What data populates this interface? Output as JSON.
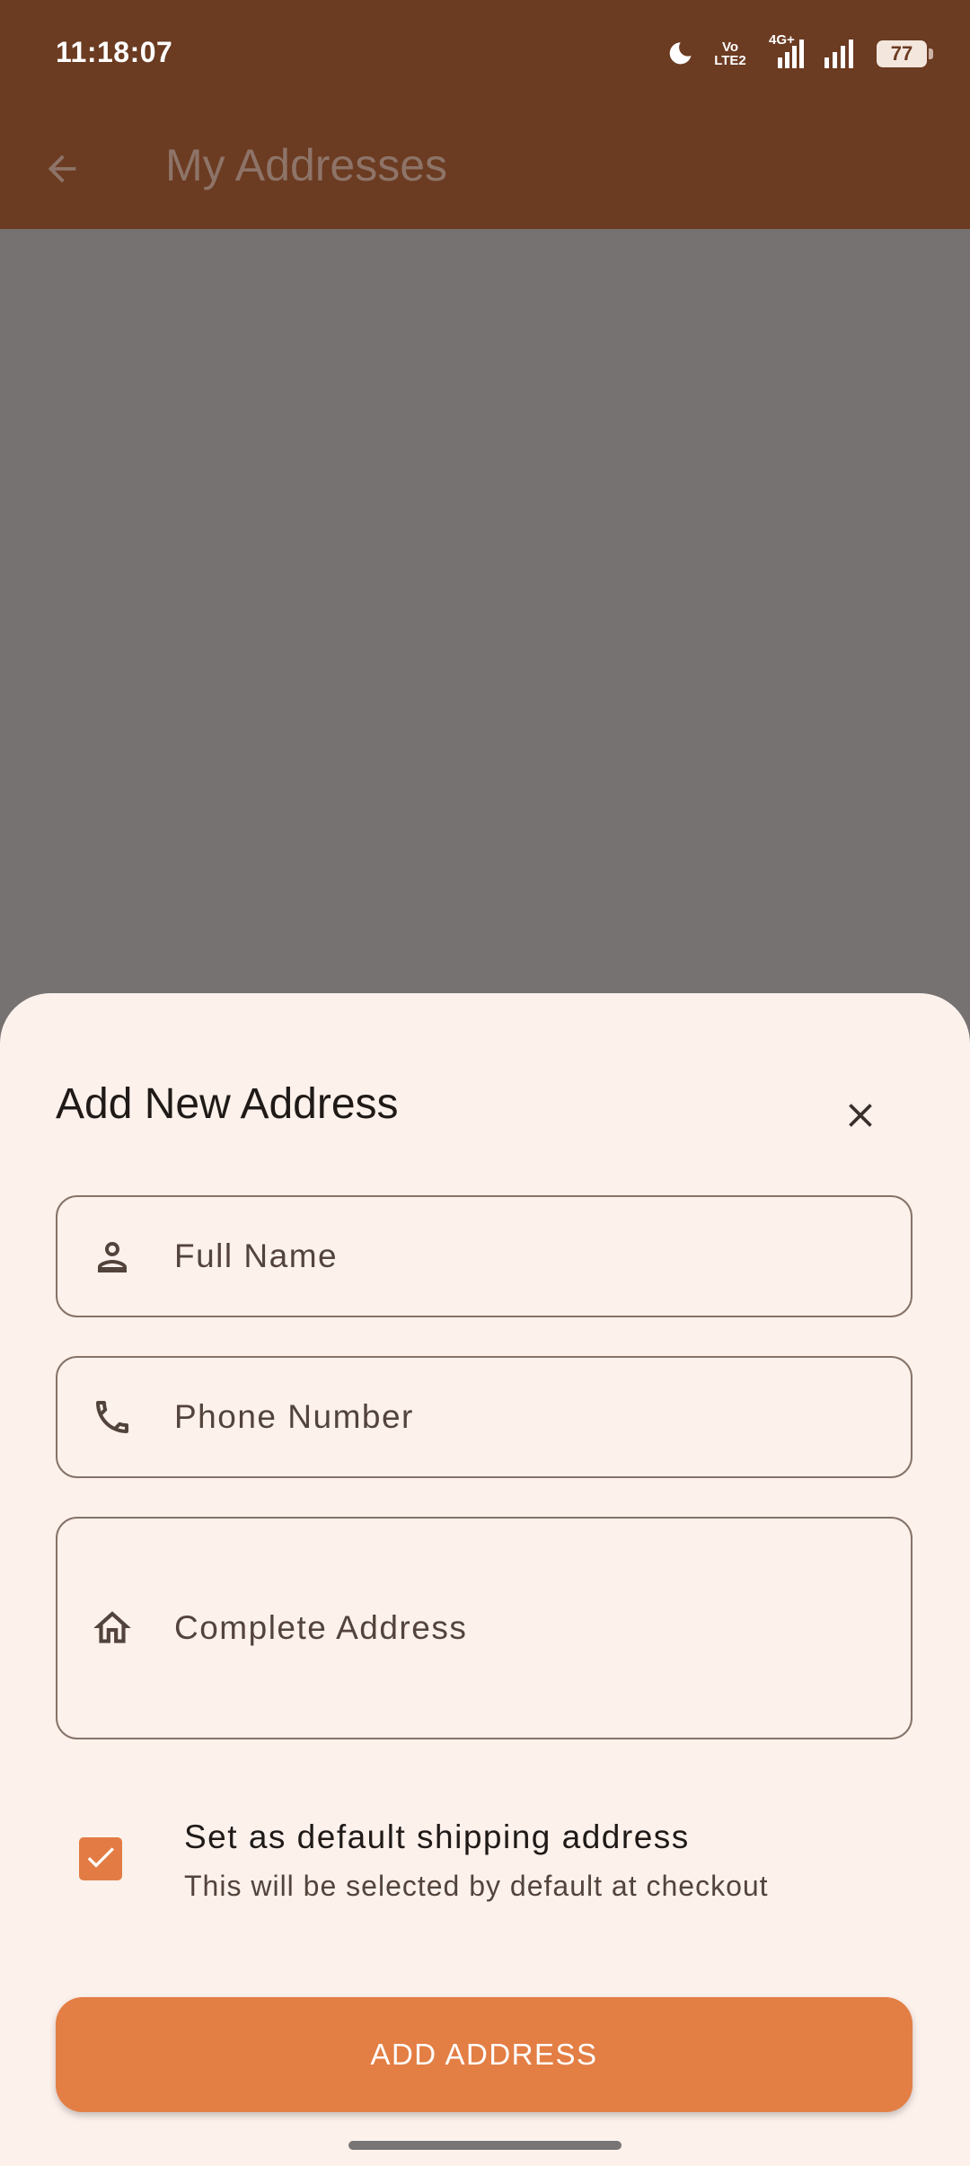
{
  "status_bar": {
    "time": "11:18:07",
    "network_label": "Vo LTE2",
    "network_type": "4G+",
    "battery": "77",
    "icons": [
      "moon-icon",
      "volte-icon",
      "signal-icon",
      "signal-icon",
      "battery-icon"
    ]
  },
  "app_bar": {
    "title": "My Addresses",
    "back_icon": "arrow-left-icon"
  },
  "sheet": {
    "title": "Add New Address",
    "close_icon": "close-icon",
    "fields": {
      "full_name": {
        "placeholder": "Full Name",
        "value": "",
        "icon": "person-icon"
      },
      "phone": {
        "placeholder": "Phone Number",
        "value": "",
        "icon": "phone-icon"
      },
      "address": {
        "placeholder": "Complete Address",
        "value": "",
        "icon": "home-icon"
      }
    },
    "default_option": {
      "checked": true,
      "title": "Set as default shipping address",
      "subtitle": "This will be selected by default at checkout"
    },
    "submit_label": "ADD ADDRESS"
  },
  "colors": {
    "app_bar": "#6b3b22",
    "scrim": "#767272",
    "sheet_background": "#fdf1ec",
    "accent": "#e37e44",
    "outline": "#857368"
  }
}
